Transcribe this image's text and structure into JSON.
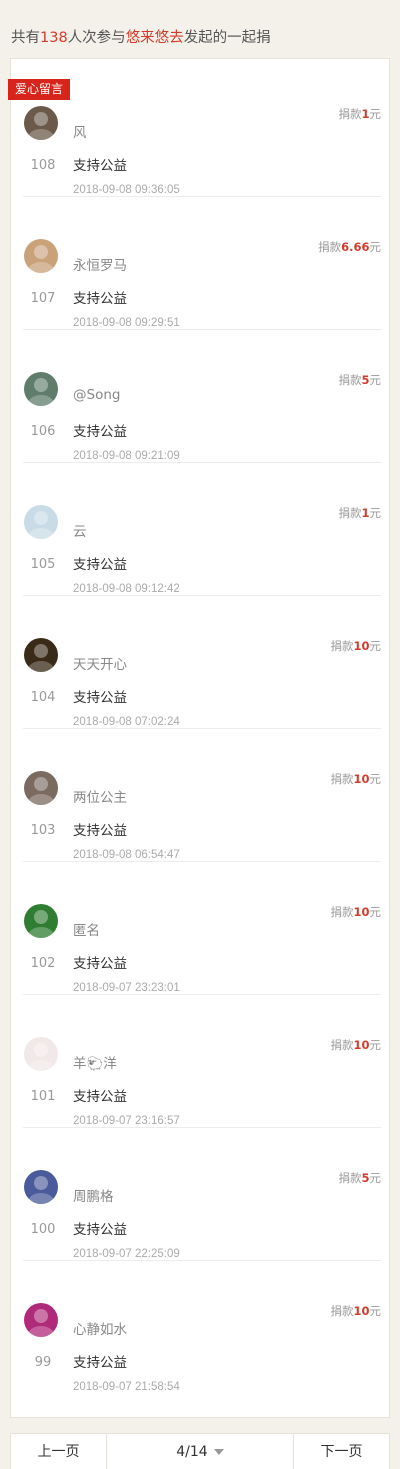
{
  "summary": {
    "prefix": "共有",
    "count": "138",
    "middle": "人次参与",
    "organizer": "悠来悠去",
    "suffix": "发起的一起捐"
  },
  "tag": "爱心留言",
  "amount_prefix": "捐款",
  "amount_suffix": "元",
  "entries": [
    {
      "rank": "108",
      "name": "风",
      "message": "支持公益",
      "time": "2018-09-08 09:36:05",
      "amount": "1"
    },
    {
      "rank": "107",
      "name": "永恒罗马",
      "message": "支持公益",
      "time": "2018-09-08 09:29:51",
      "amount": "6.66"
    },
    {
      "rank": "106",
      "name": "@Song",
      "message": "支持公益",
      "time": "2018-09-08 09:21:09",
      "amount": "5"
    },
    {
      "rank": "105",
      "name": "云",
      "message": "支持公益",
      "time": "2018-09-08 09:12:42",
      "amount": "1"
    },
    {
      "rank": "104",
      "name": "天天开心",
      "message": "支持公益",
      "time": "2018-09-08 07:02:24",
      "amount": "10"
    },
    {
      "rank": "103",
      "name": "两位公主",
      "message": "支持公益",
      "time": "2018-09-08 06:54:47",
      "amount": "10"
    },
    {
      "rank": "102",
      "name": "匿名",
      "message": "支持公益",
      "time": "2018-09-07 23:23:01",
      "amount": "10"
    },
    {
      "rank": "101",
      "name": "羊🐑洋",
      "message": "支持公益",
      "time": "2018-09-07 23:16:57",
      "amount": "10"
    },
    {
      "rank": "100",
      "name": "周鹏格",
      "message": "支持公益",
      "time": "2018-09-07 22:25:09",
      "amount": "5"
    },
    {
      "rank": "99",
      "name": "心静如水",
      "message": "支持公益",
      "time": "2018-09-07 21:58:54",
      "amount": "10"
    }
  ],
  "avatar_colors": [
    "#6b5a4a",
    "#c9a27a",
    "#5f7d6a",
    "#c8dbe6",
    "#3a2a18",
    "#7a6a60",
    "#2f7d32",
    "#f1e8e8",
    "#4a5a9a",
    "#b02a7a"
  ],
  "pager": {
    "prev": "上一页",
    "page": "4/14",
    "next": "下一页"
  }
}
